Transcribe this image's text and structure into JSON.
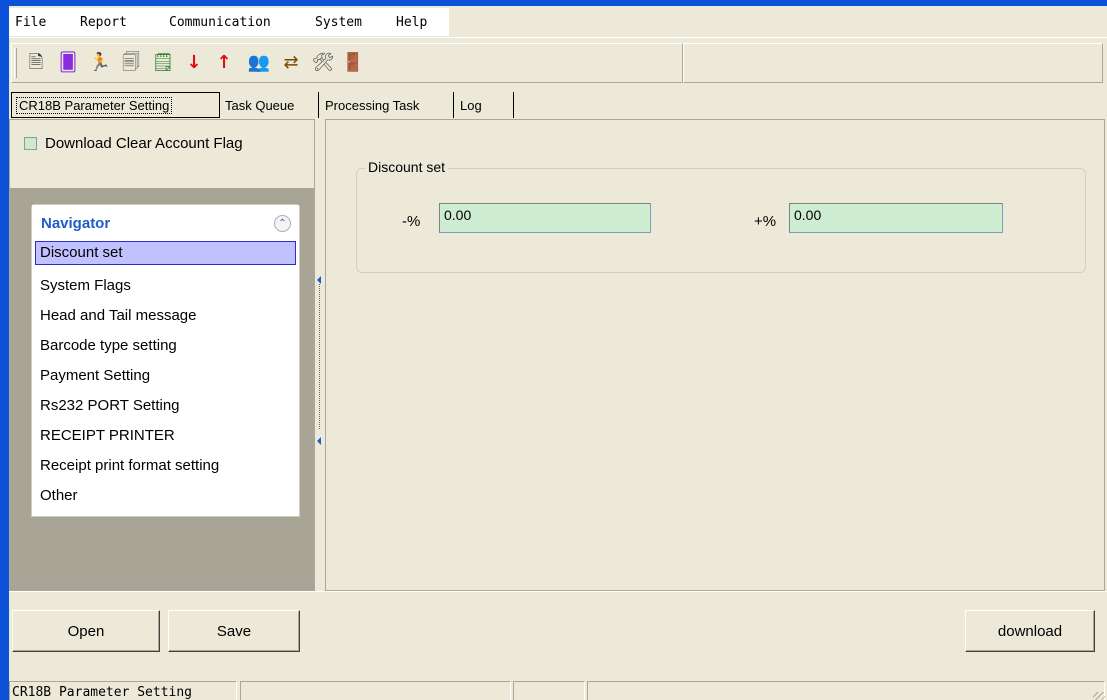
{
  "menu": {
    "items": [
      {
        "label": "File"
      },
      {
        "label": "Report"
      },
      {
        "label": "Communication"
      },
      {
        "label": "System"
      },
      {
        "label": "Help"
      }
    ]
  },
  "toolbar": {
    "buttons": [
      {
        "icon": "new-document-icon",
        "glyph": "🗎"
      },
      {
        "icon": "cards-icon",
        "glyph": "🂠"
      },
      {
        "icon": "runner-icon",
        "glyph": "🏃"
      },
      {
        "icon": "copy-document-icon",
        "glyph": "🗐"
      },
      {
        "icon": "open-document-icon",
        "glyph": "🗒"
      },
      {
        "icon": "download-arrow-icon",
        "glyph": "↓"
      },
      {
        "icon": "upload-arrow-icon",
        "glyph": "↑"
      },
      {
        "icon": "users-icon",
        "glyph": "👥"
      },
      {
        "icon": "transfer-icon",
        "glyph": "⇄"
      },
      {
        "icon": "tools-icon",
        "glyph": "🛠"
      },
      {
        "icon": "exit-door-icon",
        "glyph": "🚪"
      }
    ]
  },
  "tabs": [
    {
      "label": "CR18B Parameter Setting",
      "active": true
    },
    {
      "label": "Task Queue"
    },
    {
      "label": "Processing Task"
    },
    {
      "label": "Log"
    }
  ],
  "left": {
    "checkbox_label": "Download Clear Account Flag",
    "navigator": {
      "title": "Navigator",
      "collapse_glyph": "⌃",
      "items": [
        {
          "label": "Discount set",
          "selected": true
        },
        {
          "label": "System Flags"
        },
        {
          "label": "Head and Tail message"
        },
        {
          "label": "Barcode type setting"
        },
        {
          "label": "Payment Setting"
        },
        {
          "label": "Rs232 PORT Setting"
        },
        {
          "label": "RECEIPT PRINTER"
        },
        {
          "label": "Receipt print format setting"
        },
        {
          "label": "Other"
        }
      ]
    }
  },
  "discount": {
    "group_title": "Discount set",
    "minus_label": "-%",
    "minus_value": "0.00",
    "plus_label": "+%",
    "plus_value": "0.00"
  },
  "buttons": {
    "open": "Open",
    "save": "Save",
    "download": "download"
  },
  "status": {
    "pane1": "CR18B Parameter Setting",
    "pane2": "",
    "pane3": "",
    "pane4": ""
  },
  "colors": {
    "window_bg": "#ece9d8",
    "frame_blue": "#0a53d8",
    "input_green": "#cdecd1",
    "nav_title": "#215dc6",
    "selected_bg": "#c1c1ff"
  }
}
